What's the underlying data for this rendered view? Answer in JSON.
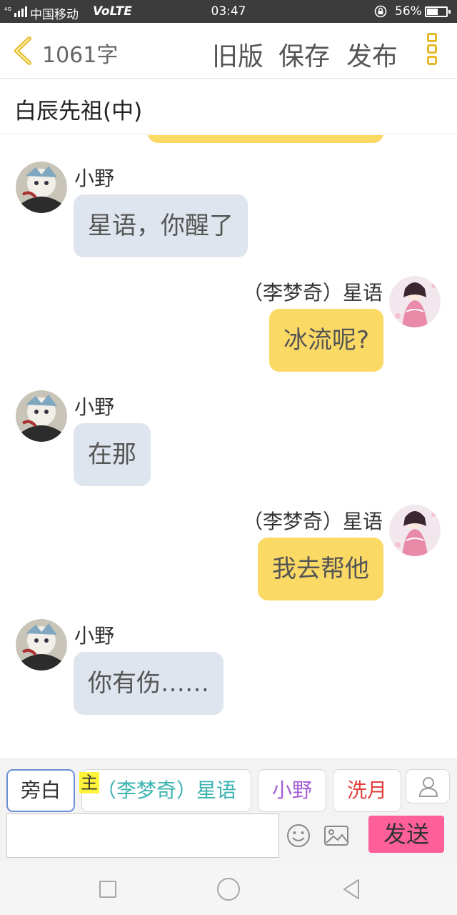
{
  "status_bar": {
    "network": "4G",
    "carrier": "中国移动",
    "volte": "VoLTE",
    "time": "03:47",
    "battery_pct": "56%",
    "battery_level": 0.56
  },
  "header": {
    "word_count": "1061字",
    "old_version": "旧版",
    "save": "保存",
    "publish": "发布"
  },
  "title": "白辰先祖(中)",
  "messages": [
    {
      "side": "left",
      "sender": "小野",
      "text": "星语，你醒了",
      "avatar": "boy-avatar"
    },
    {
      "side": "right",
      "sender": "（李梦奇）星语",
      "text": "冰流呢?",
      "avatar": "girl-avatar"
    },
    {
      "side": "left",
      "sender": "小野",
      "text": "在那",
      "avatar": "boy-avatar"
    },
    {
      "side": "right",
      "sender": "（李梦奇）星语",
      "text": "我去帮他",
      "avatar": "girl-avatar"
    },
    {
      "side": "left",
      "sender": "小野",
      "text": "你有伤……",
      "avatar": "boy-avatar"
    }
  ],
  "roles": [
    {
      "label": "旁白",
      "color": "#555555"
    },
    {
      "label": "（李梦奇）星语",
      "color": "#3bb3b0",
      "badge": "主"
    },
    {
      "label": "小野",
      "color": "#a45cd6"
    },
    {
      "label": "洗月",
      "color": "#e0403a"
    }
  ],
  "input": {
    "placeholder": "",
    "value": ""
  },
  "send_label": "发送",
  "colors": {
    "accent_yellow": "#fbd965",
    "left_bubble": "#dfe5ee",
    "send_button": "#ff5f98",
    "more_icon": "#e3b92a"
  }
}
